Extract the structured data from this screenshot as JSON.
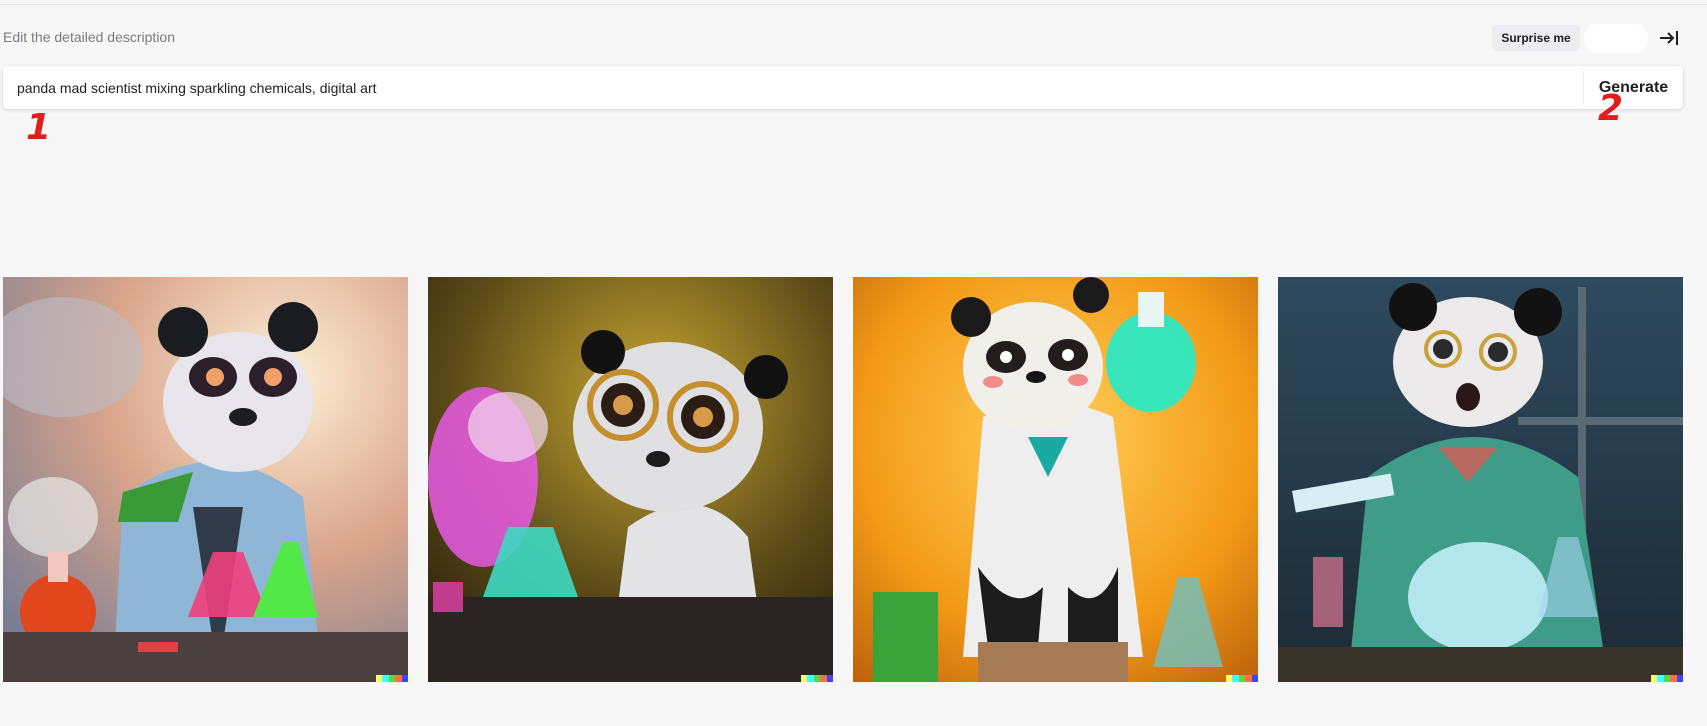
{
  "prompt_section": {
    "hint": "Edit the detailed description",
    "surprise_label": "Surprise me",
    "prompt_value": "panda mad scientist mixing sparkling chemicals, digital art",
    "generate_label": "Generate"
  },
  "annotations": [
    "1",
    "2"
  ],
  "results": [
    {
      "name": "panda-scientist-image-1"
    },
    {
      "name": "panda-scientist-image-2"
    },
    {
      "name": "panda-scientist-image-3"
    },
    {
      "name": "panda-scientist-image-4"
    }
  ],
  "colors": {
    "background": "#f7f7f8",
    "annotation": "#e21b1b",
    "watermark": [
      "#ffff66",
      "#42ffff",
      "#51da4c",
      "#ff6e3c",
      "#3c46ff"
    ]
  }
}
